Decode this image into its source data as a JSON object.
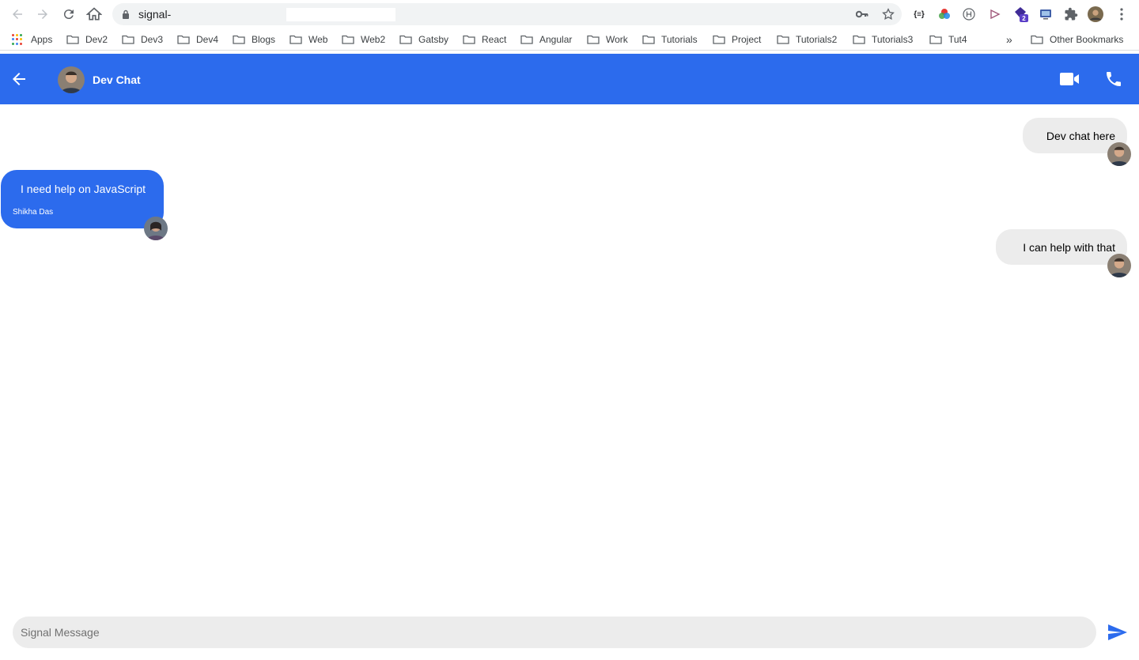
{
  "browser": {
    "url": "signal-",
    "bookmarks": [
      {
        "label": "Apps"
      },
      {
        "label": "Dev2"
      },
      {
        "label": "Dev3"
      },
      {
        "label": "Dev4"
      },
      {
        "label": "Blogs"
      },
      {
        "label": "Web"
      },
      {
        "label": "Web2"
      },
      {
        "label": "Gatsby"
      },
      {
        "label": "React"
      },
      {
        "label": "Angular"
      },
      {
        "label": "Work"
      },
      {
        "label": "Tutorials"
      },
      {
        "label": "Project"
      },
      {
        "label": "Tutorials2"
      },
      {
        "label": "Tutorials3"
      },
      {
        "label": "Tut4"
      }
    ],
    "overflow": "»",
    "other_bookmarks": "Other Bookmarks",
    "ext_badge": "2",
    "ext_json": "{≡}"
  },
  "header": {
    "title": "Dev Chat"
  },
  "messages": [
    {
      "type": "sent",
      "text": "Dev chat here"
    },
    {
      "type": "received",
      "text": "I need help on JavaScript",
      "sender": "Shikha Das"
    },
    {
      "type": "sent",
      "text": "I can help with that"
    }
  ],
  "composer": {
    "placeholder": "Signal Message"
  },
  "colors": {
    "accent": "#2c6bed",
    "bubble_sent": "#ececec"
  }
}
